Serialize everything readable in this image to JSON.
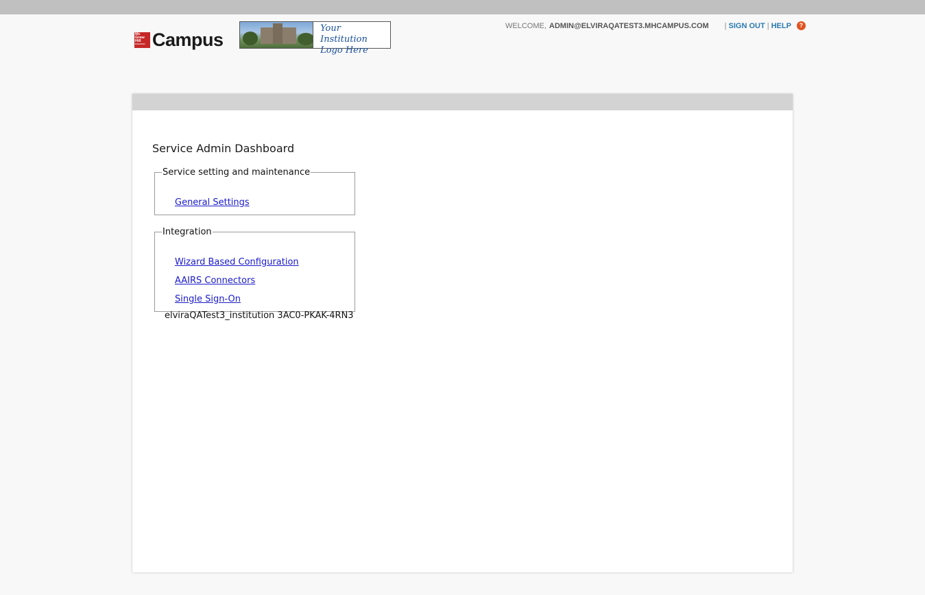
{
  "header": {
    "brand_lines": [
      "Mc",
      "Graw",
      "Hill",
      "Education"
    ],
    "brand_name": "Campus",
    "institution_logo_line1": "Your Institution",
    "institution_logo_line2": "Logo Here",
    "welcome_label": "WELCOME,",
    "welcome_user": "ADMIN@ELVIRAQATEST3.MHCAMPUS.COM",
    "separator": "|",
    "sign_out_label": "SIGN OUT",
    "help_label": "HELP",
    "help_icon_glyph": "?"
  },
  "main": {
    "title": "Service Admin Dashboard",
    "groups": [
      {
        "legend": "Service setting and maintenance",
        "links": [
          "General Settings"
        ]
      },
      {
        "legend": "Integration",
        "links": [
          "Wizard Based Configuration",
          "AAIRS Connectors",
          "Single Sign-On"
        ]
      }
    ],
    "institution_id": "elviraQATest3_institution 3AC0-PKAK-4RN3"
  },
  "colors": {
    "topbar": "#c0c0c0",
    "content_bar": "#d3d3d3",
    "nav_link": "#2a7ab0",
    "help_icon": "#e0531f",
    "body_link": "#1a1acc",
    "brand_red": "#c62828"
  }
}
